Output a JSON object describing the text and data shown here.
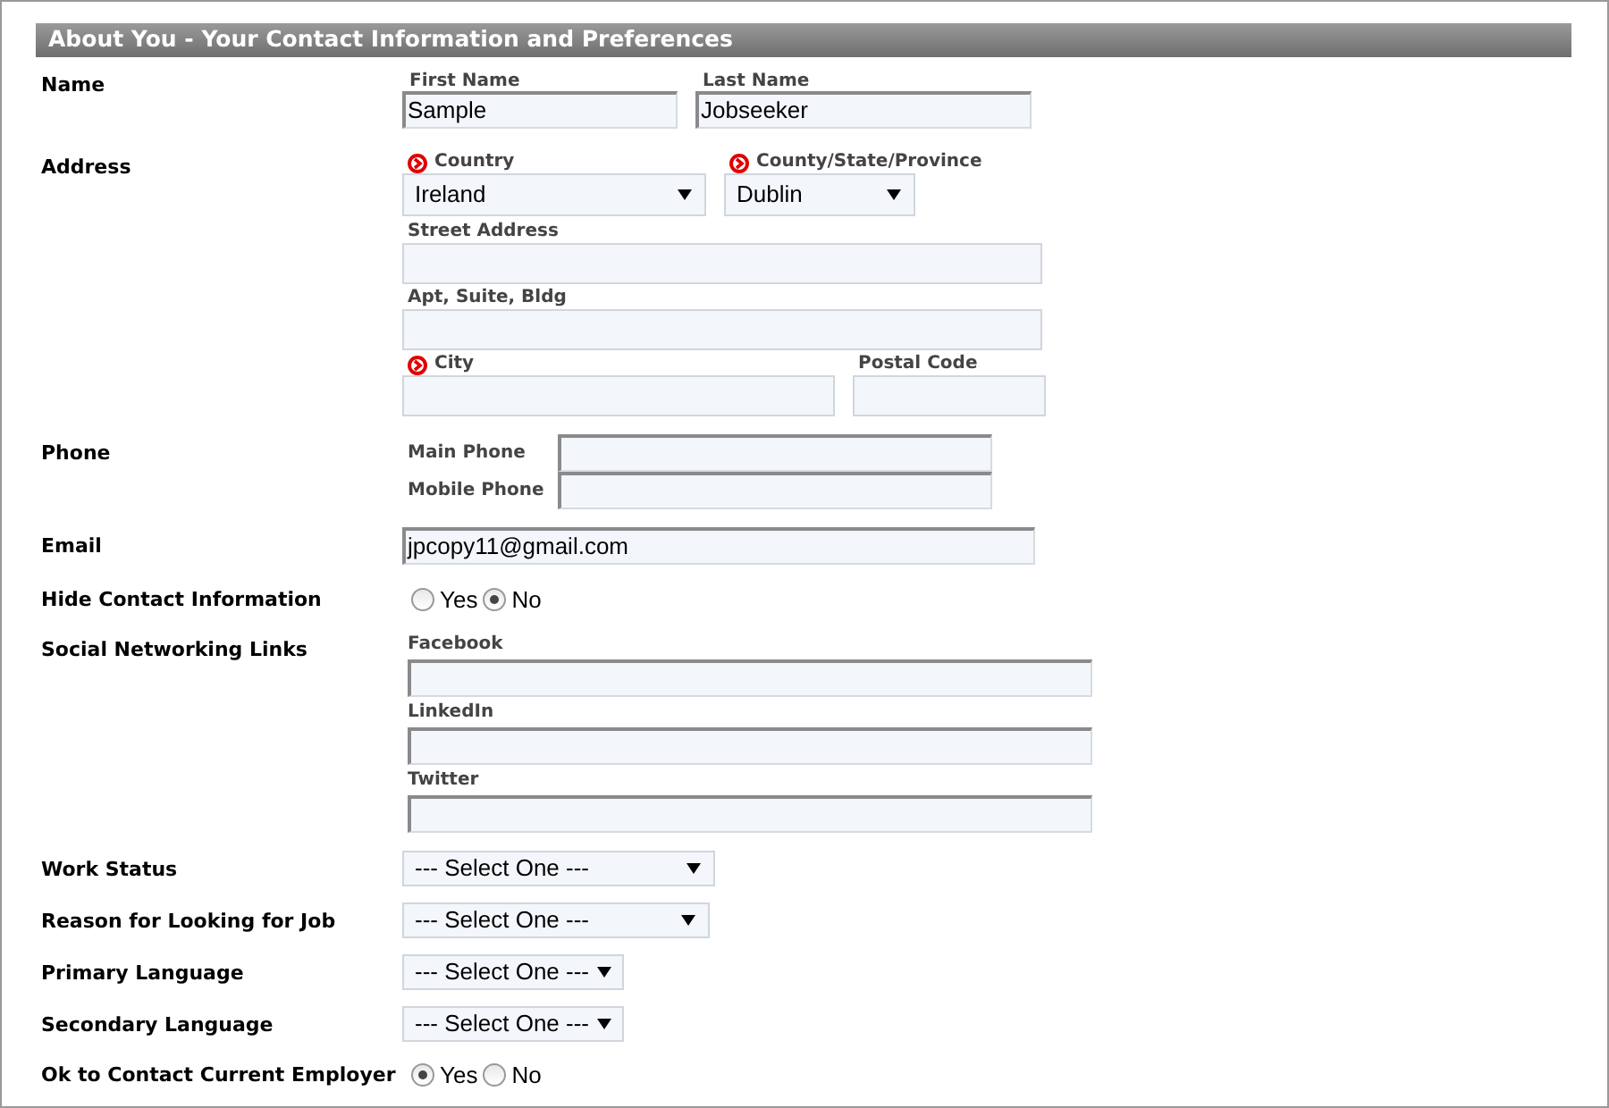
{
  "section_title": "About You - Your Contact Information and Preferences",
  "rows": [
    {
      "kind": "name",
      "label": "Name",
      "fields": [
        {
          "label": "First Name",
          "value": "Sample"
        },
        {
          "label": "Last Name",
          "value": "Jobseeker"
        }
      ]
    },
    {
      "kind": "address",
      "label": "Address",
      "selects": [
        {
          "label": "Country",
          "required": true,
          "value": "Ireland"
        },
        {
          "label": "County/State/Province",
          "required": true,
          "value": "Dublin"
        }
      ],
      "street": {
        "label": "Street Address",
        "required": false
      },
      "apt": {
        "label": "Apt, Suite, Bldg",
        "required": false
      },
      "city": {
        "label": "City",
        "required": true
      },
      "postal": {
        "label": "Postal Code",
        "required": false
      }
    },
    {
      "kind": "phone",
      "label": "Phone",
      "fields": [
        {
          "label": "Main Phone"
        },
        {
          "label": "Mobile Phone"
        }
      ]
    },
    {
      "kind": "text",
      "label": "Email",
      "value": "jpcopy11@gmail.com"
    },
    {
      "kind": "radio",
      "label": "Hide Contact Information",
      "options": [
        {
          "label": "Yes",
          "selected": false
        },
        {
          "label": "No",
          "selected": true
        }
      ]
    },
    {
      "kind": "stacked",
      "label": "Social Networking Links",
      "fields": [
        {
          "label": "Facebook"
        },
        {
          "label": "LinkedIn"
        },
        {
          "label": "Twitter"
        }
      ]
    },
    {
      "kind": "select",
      "label": "Work Status",
      "value": "--- Select One ---"
    },
    {
      "kind": "select",
      "label": "Reason for Looking for Job",
      "value": "--- Select One ---"
    },
    {
      "kind": "select",
      "label": "Primary Language",
      "value": "--- Select One ---"
    },
    {
      "kind": "select",
      "label": "Secondary Language",
      "value": "--- Select One ---"
    },
    {
      "kind": "radio",
      "label": "Ok to Contact Current Employer",
      "options": [
        {
          "label": "Yes",
          "selected": true
        },
        {
          "label": "No",
          "selected": false
        }
      ]
    }
  ]
}
